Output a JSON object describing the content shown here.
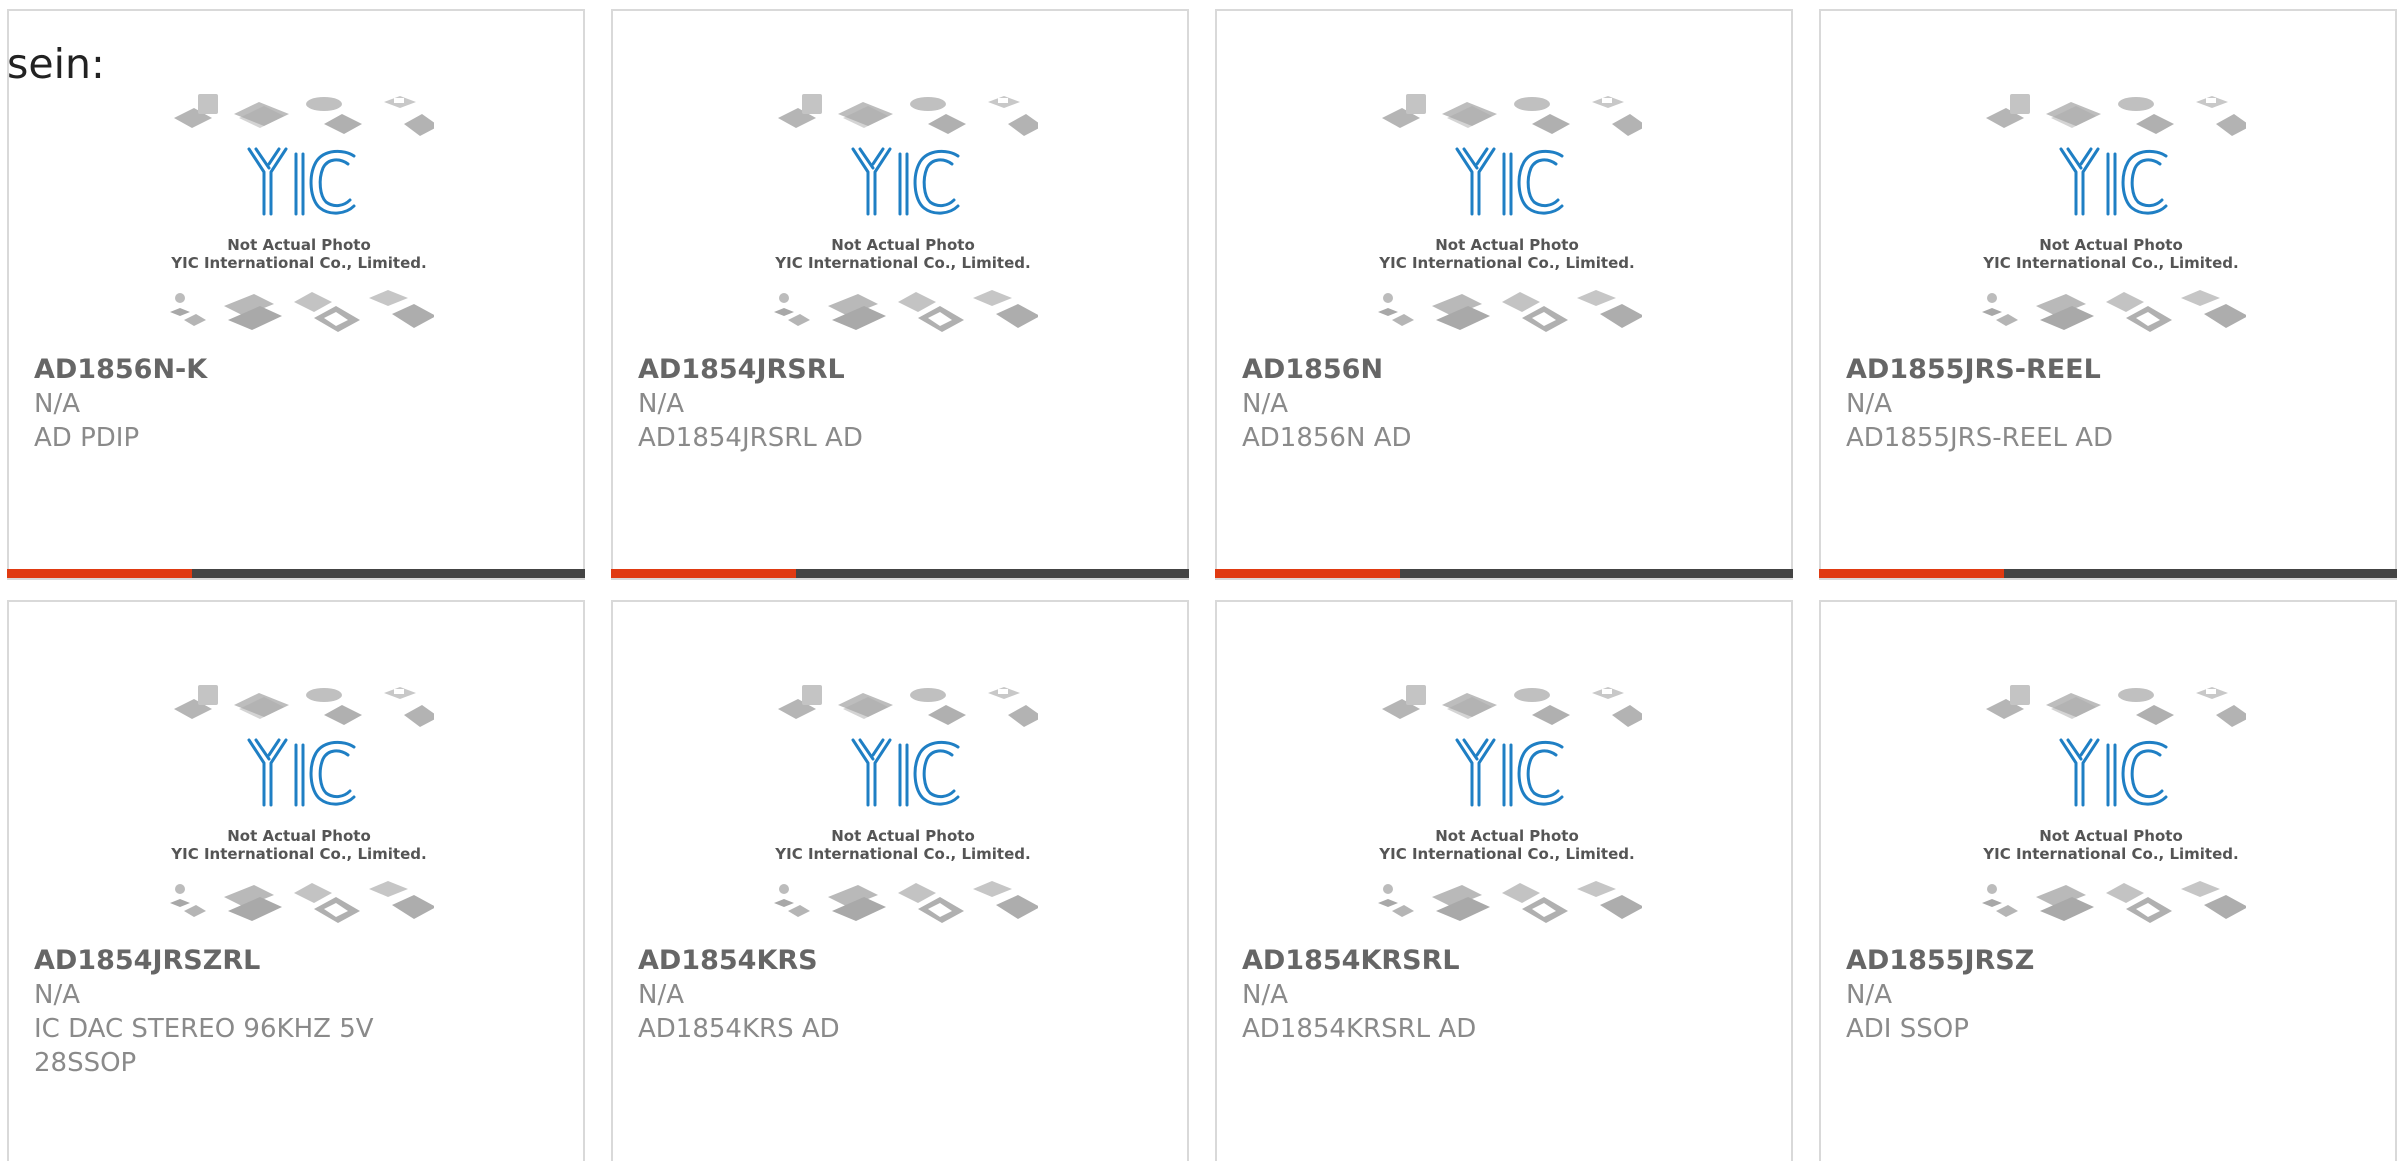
{
  "leading_text": "sein:",
  "thumbnail": {
    "logo_text": "YIC",
    "caption_line1": "Not Actual Photo",
    "caption_line2": "YIC International Co., Limited."
  },
  "colors": {
    "accent": "#e03a12",
    "bar_track": "#444444",
    "logo_blue": "#1f7fc4",
    "chip_gray": "#b3b3b3"
  },
  "products": [
    {
      "part_number": "AD1856N-K",
      "manufacturer": "N/A",
      "description": "AD PDIP",
      "progress": 0.32
    },
    {
      "part_number": "AD1854JRSRL",
      "manufacturer": "N/A",
      "description": "AD1854JRSRL AD",
      "progress": 0.32
    },
    {
      "part_number": "AD1856N",
      "manufacturer": "N/A",
      "description": "AD1856N AD",
      "progress": 0.32
    },
    {
      "part_number": "AD1855JRS-REEL",
      "manufacturer": "N/A",
      "description": "AD1855JRS-REEL AD",
      "progress": 0.32
    },
    {
      "part_number": "AD1854JRSZRL",
      "manufacturer": "N/A",
      "description": "IC DAC STEREO 96KHZ 5V 28SSOP"
    },
    {
      "part_number": "AD1854KRS",
      "manufacturer": "N/A",
      "description": "AD1854KRS AD"
    },
    {
      "part_number": "AD1854KRSRL",
      "manufacturer": "N/A",
      "description": "AD1854KRSRL AD"
    },
    {
      "part_number": "AD1855JRSZ",
      "manufacturer": "N/A",
      "description": "ADI SSOP"
    }
  ]
}
